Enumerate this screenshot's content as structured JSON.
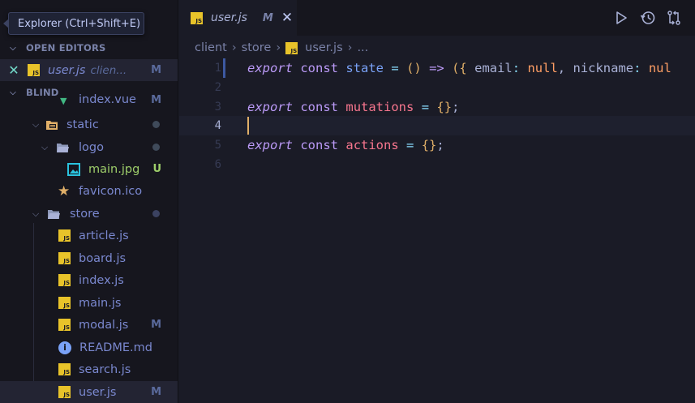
{
  "tooltip": "Explorer (Ctrl+Shift+E)",
  "sidebar": {
    "open_editors_title": "OPEN EDITORS",
    "open_editor": {
      "name": "user.js",
      "folder": "clien...",
      "badge": "M"
    },
    "project_title": "BLIND",
    "tree": [
      {
        "label": "index.vue",
        "badge": "M",
        "type": "vue",
        "depth": 3
      },
      {
        "label": "static",
        "type": "folder-open-special",
        "depth": 1,
        "status": "dot"
      },
      {
        "label": "logo",
        "type": "folder-open",
        "depth": 2,
        "status": "dot"
      },
      {
        "label": "main.jpg",
        "type": "image",
        "depth": 3,
        "badge": "U"
      },
      {
        "label": "favicon.ico",
        "type": "star",
        "depth": 2
      },
      {
        "label": "store",
        "type": "folder-open",
        "depth": 1,
        "status": "dot-blue"
      },
      {
        "label": "article.js",
        "type": "js",
        "depth": 2
      },
      {
        "label": "board.js",
        "type": "js",
        "depth": 2
      },
      {
        "label": "index.js",
        "type": "js",
        "depth": 2
      },
      {
        "label": "main.js",
        "type": "js",
        "depth": 2
      },
      {
        "label": "modal.js",
        "type": "js",
        "depth": 2,
        "badge": "M"
      },
      {
        "label": "README.md",
        "type": "info",
        "depth": 2
      },
      {
        "label": "search.js",
        "type": "js",
        "depth": 2
      },
      {
        "label": "user.js",
        "type": "js",
        "depth": 2,
        "badge": "M",
        "active": true
      }
    ]
  },
  "tab": {
    "name": "user.js",
    "badge": "M",
    "close": "✕",
    "icon_text": "JS"
  },
  "actions": [
    "run-icon",
    "history-icon",
    "compare-icon"
  ],
  "breadcrumb": {
    "parts": [
      "client",
      "store"
    ],
    "file": "user.js",
    "ellipsis": "..."
  },
  "code": {
    "line_numbers": [
      "1",
      "2",
      "3",
      "4",
      "5",
      "6"
    ],
    "line1": {
      "kw": "export",
      "decl": "const",
      "name": "state",
      "eq": "=",
      "paren": "()",
      "arrow": "=>",
      "open": "({",
      "p1": "email",
      "c1": ":",
      "v1": "null",
      "comma": ",",
      "p2": "nickname",
      "c2": ":",
      "v2": "nul"
    },
    "line3": {
      "kw": "export",
      "decl": "const",
      "name": "mutations",
      "eq": "=",
      "val": "{}",
      "semi": ";"
    },
    "line5": {
      "kw": "export",
      "decl": "const",
      "name": "actions",
      "eq": "=",
      "val": "{}",
      "semi": ";"
    },
    "current_line": "4"
  },
  "colors": {
    "accent": "#7aa2f7",
    "keyword": "#bb9af7",
    "js_icon": "#e8c32a",
    "cursor": "#e0af68"
  }
}
